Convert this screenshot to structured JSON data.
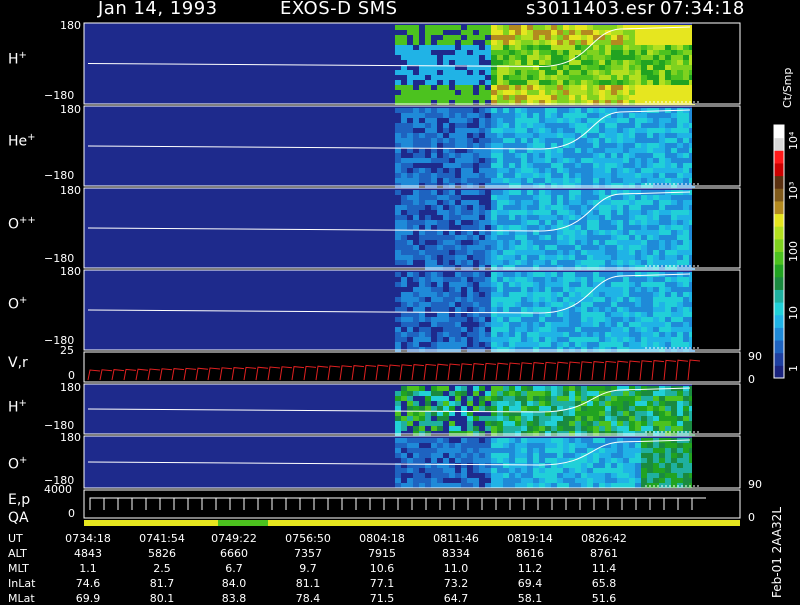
{
  "header": {
    "date": "Jan 14, 1993",
    "instrument": "EXOS-D SMS",
    "file": "s3011403.esr",
    "time": "07:34:18"
  },
  "colorbar": {
    "unit_label": "Ct/Smp",
    "ticks": [
      "1",
      "10",
      "100",
      "10³",
      "10⁴"
    ],
    "colors": [
      "#1a237e",
      "#1e3fa0",
      "#1e63c0",
      "#1f8ad8",
      "#20b3e6",
      "#21d0d8",
      "#1fb0a0",
      "#1a8a40",
      "#21a321",
      "#4cc21f",
      "#7fd21f",
      "#b3e01f",
      "#e6e61f",
      "#b38a1f",
      "#805a1a",
      "#5a3010",
      "#cc0000",
      "#ff1a1a",
      "#d9d9d9",
      "#ffffff"
    ]
  },
  "panels": [
    {
      "name": "H",
      "sup": "+",
      "y_top": "180",
      "y_bot": "−180"
    },
    {
      "name": "He",
      "sup": "+",
      "y_top": "180",
      "y_bot": "−180"
    },
    {
      "name": "O",
      "sup": "++",
      "y_top": "180",
      "y_bot": "−180"
    },
    {
      "name": "O",
      "sup": "+",
      "y_top": "180",
      "y_bot": "−180"
    },
    {
      "name": "V,r",
      "sup": "",
      "y_top": "25",
      "y_bot": "0",
      "right_top": "90",
      "right_bot": "0"
    },
    {
      "name": "H",
      "sup": "+",
      "y_top": "180",
      "y_bot": "−180"
    },
    {
      "name": "O",
      "sup": "+",
      "y_top": "180",
      "y_bot": "−180",
      "right_bot": "90"
    },
    {
      "name": "E,p",
      "sup": "",
      "y_top": "4000",
      "y_bot": "0",
      "right_bot": "0"
    }
  ],
  "qa_label": "QA",
  "side_note": "Feb-01 2AA32L",
  "orbit_table": {
    "rows": [
      {
        "label": "UT",
        "values": [
          "0734:18",
          "0741:54",
          "0749:22",
          "0756:50",
          "0804:18",
          "0811:46",
          "0819:14",
          "0826:42"
        ]
      },
      {
        "label": "ALT",
        "values": [
          "4843",
          "5826",
          "6660",
          "7357",
          "7915",
          "8334",
          "8616",
          "8761"
        ]
      },
      {
        "label": "MLT",
        "values": [
          "1.1",
          "2.5",
          "6.7",
          "9.7",
          "10.6",
          "11.0",
          "11.2",
          "11.4"
        ]
      },
      {
        "label": "InLat",
        "values": [
          "74.6",
          "81.7",
          "84.0",
          "81.1",
          "77.1",
          "73.2",
          "69.4",
          "65.8"
        ]
      },
      {
        "label": "MLat",
        "values": [
          "69.9",
          "80.1",
          "83.8",
          "78.4",
          "71.5",
          "64.7",
          "58.1",
          "51.6"
        ]
      }
    ]
  },
  "chart_data": {
    "type": "heatmap",
    "title": "Jan 14, 1993   EXOS-D SMS",
    "x_ticks_ut": [
      "0734:18",
      "0741:54",
      "0749:22",
      "0756:50",
      "0804:18",
      "0811:46",
      "0819:14",
      "0826:42"
    ],
    "panels": [
      "H+",
      "He+",
      "O++",
      "O+",
      "V,r",
      "H+",
      "O+",
      "E,p"
    ],
    "ylim_angle": [
      -180,
      180
    ],
    "ylim_vr": [
      0,
      25
    ],
    "ylim_ep": [
      0,
      4000
    ],
    "colorbar_range": [
      1,
      10000
    ],
    "colorbar_scale": "log"
  }
}
